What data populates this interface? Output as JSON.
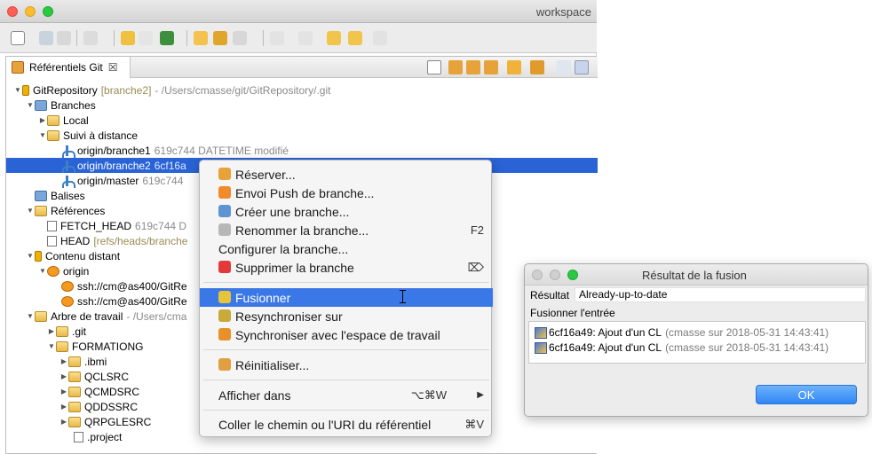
{
  "window": {
    "title": "workspace"
  },
  "view": {
    "tab_label": "Référentiels Git",
    "tab_close": "☒"
  },
  "tree": {
    "repo": {
      "name": "GitRepository",
      "branch": "[branche2]",
      "path": "- /Users/cmasse/git/GitRepository/.git"
    },
    "branches": "Branches",
    "local": "Local",
    "remote_tracking": "Suivi à distance",
    "b1": {
      "name": "origin/branche1",
      "info": "619c744 DATETIME modifié"
    },
    "b2": {
      "name": "origin/branche2",
      "info": "6cf16a"
    },
    "b3": {
      "name": "origin/master",
      "info": "619c744"
    },
    "tags": "Balises",
    "refs": "Références",
    "fetch_head": {
      "name": "FETCH_HEAD",
      "info": "619c744 D"
    },
    "head": {
      "name": "HEAD",
      "info": "[refs/heads/branche"
    },
    "remotes": "Contenu distant",
    "origin": "origin",
    "ssh1": "ssh://cm@as400/GitRe",
    "ssh2": "ssh://cm@as400/GitRe",
    "worktree": {
      "name": "Arbre de travail",
      "info": "- /Users/cma"
    },
    "git": ".git",
    "formation": "FORMATIONG",
    "ibmi": ".ibmi",
    "qclsrc": "QCLSRC",
    "qcmdsrc": "QCMDSRC",
    "qddssrc": "QDDSSRC",
    "qrpglesrc": "QRPGLESRC",
    "project": ".project"
  },
  "menu": {
    "checkout": "Réserver...",
    "push": "Envoi Push de branche...",
    "create": "Créer une branche...",
    "rename": "Renommer la branche...",
    "rename_key": "F2",
    "configure": "Configurer la branche...",
    "delete": "Supprimer la branche",
    "delete_key": "⌦",
    "merge": "Fusionner",
    "rebase": "Resynchroniser sur",
    "sync": "Synchroniser avec l'espace de travail",
    "reset": "Réinitialiser...",
    "show_in": "Afficher dans",
    "show_in_key": "⌥⌘W",
    "show_in_arrow": "▶",
    "copy_path": "Coller le chemin ou l'URI du référentiel",
    "copy_key": "⌘V"
  },
  "dialog": {
    "title": "Résultat de la fusion",
    "result_label": "Résultat",
    "result_value": "Already-up-to-date",
    "merge_input_label": "Fusionner l'entrée",
    "entries": [
      {
        "commit": "6cf16a49: Ajout d'un CL",
        "meta": "(cmasse sur 2018-05-31 14:43:41)"
      },
      {
        "commit": "6cf16a49: Ajout d'un CL",
        "meta": "(cmasse sur 2018-05-31 14:43:41)"
      }
    ],
    "ok": "OK"
  }
}
